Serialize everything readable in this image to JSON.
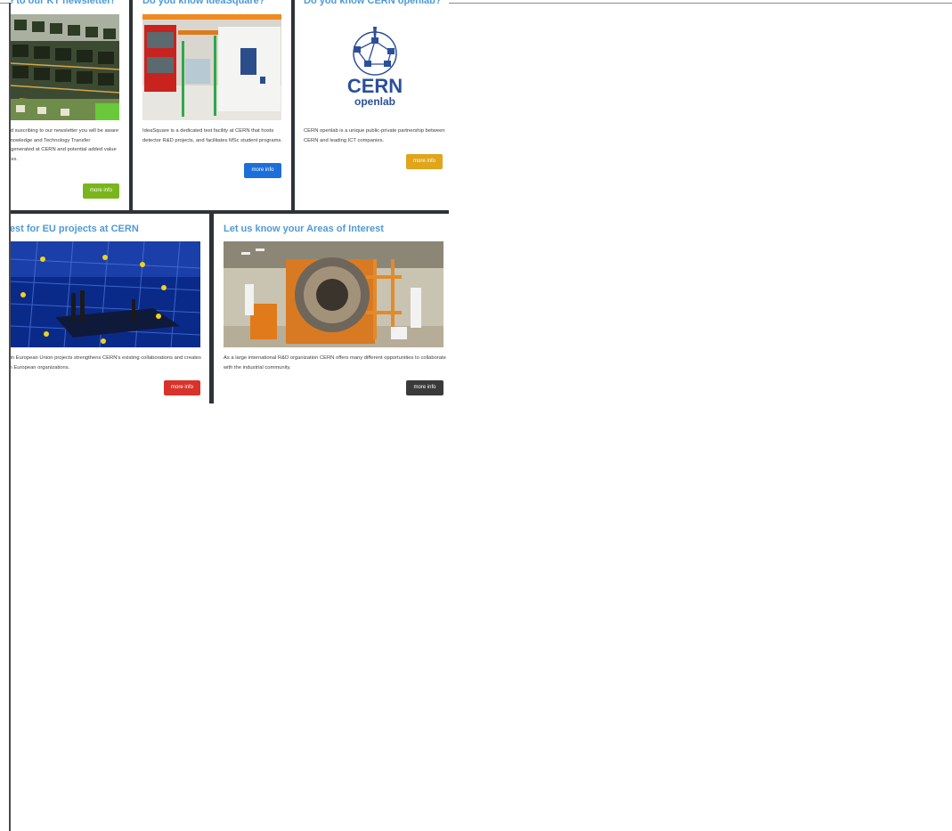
{
  "cards": {
    "newsletter": {
      "title": "Subscribe to our KT newsletter!",
      "text": "By reading and suscribing to our newsletter you will be aware of the latest Knowledge and Technology Transfer Opportunities generated at CERN and potential added value to your business.",
      "button": "more info",
      "button_color": "#7ab51d"
    },
    "ideasquare": {
      "title": "Do you know IdeaSquare?",
      "text": "IdeaSquare is a dedicated test facility at CERN that hosts detector R&D projects, and facilitates MSc student programs.",
      "button": "more info",
      "button_color": "#1c6fd8"
    },
    "openlab": {
      "title": "Do you know CERN openlab?",
      "logo_text": "CERN",
      "logo_subtext": "openlab",
      "text": "CERN openlab is a unique public-private partnership between CERN and leading ICT companies.",
      "button": "more info",
      "button_color": "#e0a51a"
    },
    "eu_projects": {
      "title": "Areas of interest for EU projects at CERN",
      "text": "Participating in European Union projects strengthens CERN's existing collaborations and creates new links with European organizations.",
      "button": "more info",
      "button_color": "#d8322b"
    },
    "areas_interest": {
      "title": "Let us know your Areas of Interest",
      "text": "As a large international R&D organization CERN offers many different opportunities to collaborate with the industrial community.",
      "button": "more info",
      "button_color": "#3a3a3a"
    }
  }
}
